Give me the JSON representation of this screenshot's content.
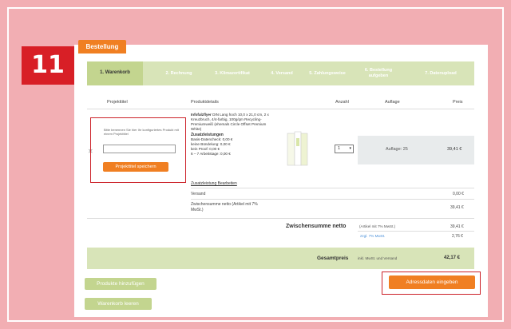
{
  "step_badge": "11",
  "order_tab": "Bestellung",
  "steps": [
    {
      "label": "1. Warenkorb",
      "active": true
    },
    {
      "label": "2. Rechnung",
      "active": false
    },
    {
      "label": "3. Klimazertifikat",
      "active": false
    },
    {
      "label": "4. Versand",
      "active": false
    },
    {
      "label": "5. Zahlungsweise",
      "active": false
    },
    {
      "label": "6. Bestellung aufgeben",
      "active": false
    },
    {
      "label": "7. Datenupload",
      "active": false
    }
  ],
  "table_headers": {
    "project_title": "Projekttitel",
    "product_details": "Produktdetails",
    "quantity": "Anzahl",
    "run": "Auflage",
    "price": "Preis"
  },
  "project": {
    "hint": "Bitte benennen Sie hier Ihr konfiguriertes Produkt mit einem Projekttitel",
    "input_value": "",
    "save_label": "Projekttitel speichern"
  },
  "product": {
    "name": "Infofalzflyer",
    "description": "DIN Lang hoch 10,0 x 21,0 cm, 2 x Kreuzbruch, 4/4-farbig, 100g/qm Recycling-Premiumweiß (ehemals Circle Offset Premium White)",
    "extras_heading": "Zusatzleistungen",
    "extras": [
      "Basis-Datencheck: 0,00 €",
      "keine Bündelung: 0,00 €",
      "kein Proof: 0,00 €",
      "6 – 7 Arbeitstage: 0,00 €"
    ],
    "edit_link": "Zusatzleistung Bearbeiten"
  },
  "quantity": {
    "selected": "1"
  },
  "run": "Auflage: 25",
  "line_price": "39,41 €",
  "shipping": {
    "label": "Versand",
    "value": "0,00 €"
  },
  "net_subtotal": {
    "label": "Zwischensumme netto (Artikel mit 7% MwSt.)",
    "value": "39,41 €"
  },
  "subtotal": {
    "label": "Zwischensumme netto",
    "note": "(Artikel mit 7% MwSt.)",
    "value": "39,41 €",
    "vat_note": "zzgl. 7% MwSt.",
    "vat_value": "2,76 €"
  },
  "total": {
    "label": "Gesamtpreis",
    "note": "inkl. MwSt. und Versand",
    "value": "42,17 €"
  },
  "buttons": {
    "add_products": "Produkte hinzufügen",
    "clear_cart": "Warenkorb leeren",
    "enter_address": "Adressdaten eingeben"
  }
}
